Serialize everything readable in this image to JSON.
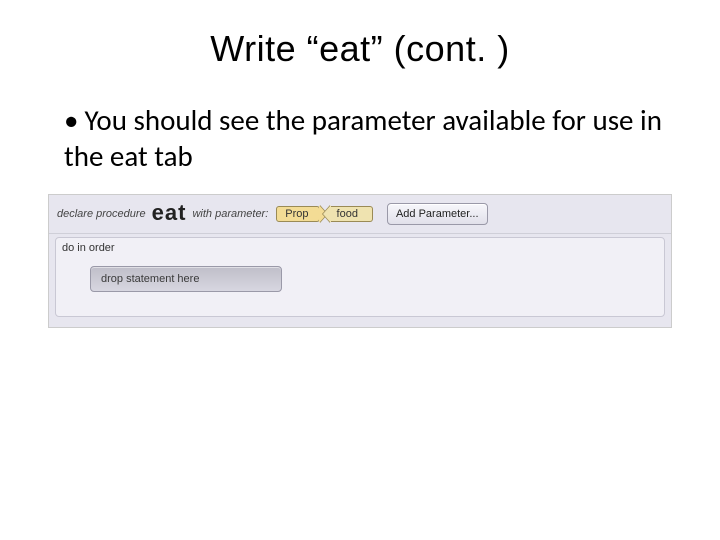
{
  "slide": {
    "title": "Write “eat” (cont. )",
    "bullet": "You should see the parameter available for use in the eat tab"
  },
  "editor": {
    "declare_pre": "declare procedure",
    "procedure_name": "eat",
    "declare_post": "with parameter:",
    "type_tag": "Prop",
    "param_name": "food",
    "add_button": "Add Parameter...",
    "order_label": "do in order",
    "drop_text": "drop statement here"
  }
}
